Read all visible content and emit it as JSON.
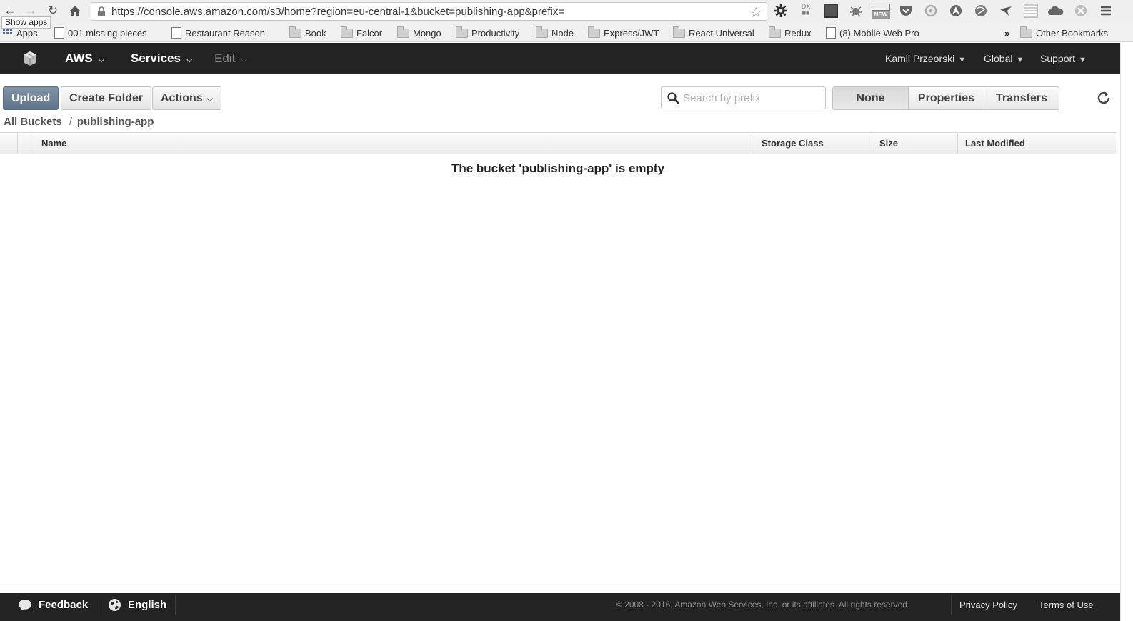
{
  "browser": {
    "url": "https://console.aws.amazon.com/s3/home?region=eu-central-1&bucket=publishing-app&prefix=",
    "tooltip": "Show apps",
    "bookmarks": [
      {
        "label": "Apps",
        "icon": "apps-grid-icon"
      },
      {
        "label": "001 missing pieces",
        "icon": "page-icon"
      },
      {
        "label": "Restaurant Reason",
        "icon": "page-icon"
      },
      {
        "label": "Book",
        "icon": "folder-icon"
      },
      {
        "label": "Falcor",
        "icon": "folder-icon"
      },
      {
        "label": "Mongo",
        "icon": "folder-icon"
      },
      {
        "label": "Productivity",
        "icon": "folder-icon"
      },
      {
        "label": "Node",
        "icon": "folder-icon"
      },
      {
        "label": "Express/JWT",
        "icon": "folder-icon"
      },
      {
        "label": "React Universal",
        "icon": "folder-icon"
      },
      {
        "label": "Redux",
        "icon": "folder-icon"
      },
      {
        "label": "(8) Mobile Web Pro",
        "icon": "page-icon"
      }
    ],
    "overflow": "»",
    "other_bookmarks": "Other Bookmarks",
    "ext_new_badge": "NEW",
    "ext_dx_label": "DX"
  },
  "header": {
    "aws": "AWS",
    "services": "Services",
    "edit": "Edit",
    "user": "Kamil Przeorski",
    "region": "Global",
    "support": "Support"
  },
  "toolbar": {
    "upload": "Upload",
    "create_folder": "Create Folder",
    "actions": "Actions",
    "search_placeholder": "Search by prefix",
    "view_none": "None",
    "view_properties": "Properties",
    "view_transfers": "Transfers"
  },
  "breadcrumb": {
    "root": "All Buckets",
    "separator": "/",
    "bucket": "publishing-app"
  },
  "table": {
    "columns": [
      "Name",
      "Storage Class",
      "Size",
      "Last Modified"
    ],
    "empty_message": "The bucket 'publishing-app' is empty"
  },
  "footer": {
    "feedback": "Feedback",
    "language": "English",
    "copyright": "© 2008 - 2016, Amazon Web Services, Inc. or its affiliates. All rights reserved.",
    "privacy": "Privacy Policy",
    "terms": "Terms of Use"
  },
  "colors": {
    "header_bg": "#232323",
    "primary_button": "#6b7f94"
  }
}
